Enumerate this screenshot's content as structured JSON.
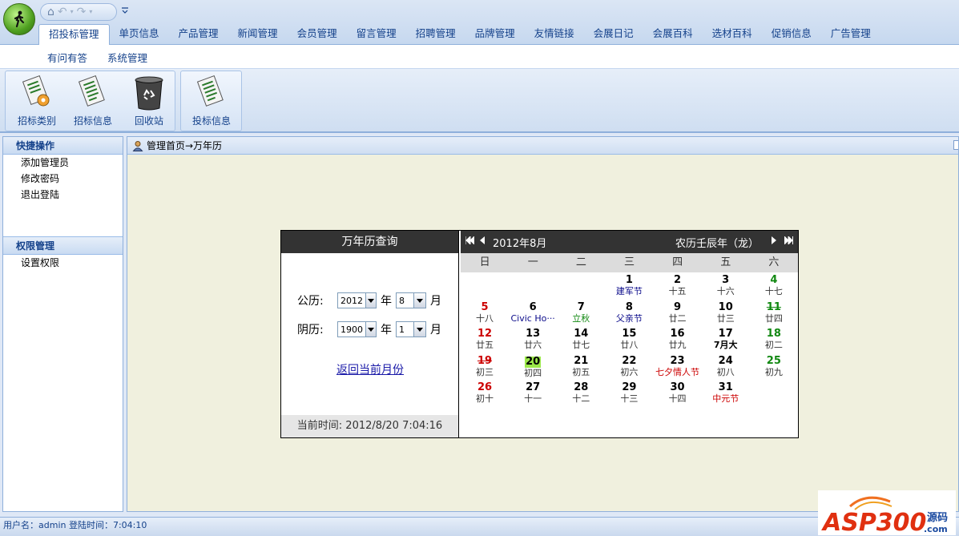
{
  "app": {
    "qat_icons": [
      "home-icon",
      "undo-icon",
      "redo-icon"
    ]
  },
  "ribbon": {
    "main_tabs": [
      "招投标管理",
      "单页信息",
      "产品管理",
      "新闻管理",
      "会员管理",
      "留言管理",
      "招聘管理",
      "品牌管理",
      "友情链接",
      "会展日记",
      "会展百科",
      "选材百科",
      "促销信息",
      "广告管理"
    ],
    "active_tab": 0,
    "sub_tabs": [
      "有问有答",
      "系统管理"
    ],
    "buttons": [
      {
        "label": "招标类别",
        "icon": "document-gear-icon"
      },
      {
        "label": "招标信息",
        "icon": "document-list-icon"
      },
      {
        "label": "回收站",
        "icon": "recycle-bin-icon"
      },
      {
        "label": "投标信息",
        "icon": "document-list-icon"
      }
    ]
  },
  "sidebar": {
    "section1_title": "快捷操作",
    "section1_items": [
      "添加管理员",
      "修改密码",
      "退出登陆"
    ],
    "section2_title": "权限管理",
    "section2_items": [
      "设置权限"
    ]
  },
  "breadcrumb": "管理首页→万年历",
  "calendar": {
    "query_title": "万年历查询",
    "solar_label": "公历:",
    "solar_year": "2012",
    "solar_month": "8",
    "lunar_label": "阴历:",
    "lunar_year": "1900",
    "lunar_month": "1",
    "year_unit": "年",
    "month_unit": "月",
    "back_link": "返回当前月份",
    "current_time": "当前时间: 2012/8/20 7:04:16",
    "year_month": "2012年8月",
    "lunar_year_label": "农历壬辰年（龙）",
    "weekdays": [
      "日",
      "一",
      "二",
      "三",
      "四",
      "五",
      "六"
    ],
    "first_weekday": 3,
    "today": 20,
    "days": [
      {
        "d": "1",
        "l": "建军节",
        "t": "hol"
      },
      {
        "d": "2",
        "l": "十五"
      },
      {
        "d": "3",
        "l": "十六"
      },
      {
        "d": "4",
        "l": "十七"
      },
      {
        "d": "5",
        "l": "十八"
      },
      {
        "d": "6",
        "l": "Civic Ho···",
        "t": "hol"
      },
      {
        "d": "7",
        "l": "立秋",
        "t": "green"
      },
      {
        "d": "8",
        "l": "父亲节",
        "t": "hol"
      },
      {
        "d": "9",
        "l": "廿二"
      },
      {
        "d": "10",
        "l": "廿三"
      },
      {
        "d": "11",
        "l": "廿四",
        "strike": true
      },
      {
        "d": "12",
        "l": "廿五"
      },
      {
        "d": "13",
        "l": "廿六"
      },
      {
        "d": "14",
        "l": "廿七"
      },
      {
        "d": "15",
        "l": "廿八"
      },
      {
        "d": "16",
        "l": "廿九"
      },
      {
        "d": "17",
        "l": "7月大",
        "t": "bold"
      },
      {
        "d": "18",
        "l": "初二"
      },
      {
        "d": "19",
        "l": "初三",
        "strike": true
      },
      {
        "d": "20",
        "l": "初四"
      },
      {
        "d": "21",
        "l": "初五"
      },
      {
        "d": "22",
        "l": "初六"
      },
      {
        "d": "23",
        "l": "七夕情人节",
        "t": "red"
      },
      {
        "d": "24",
        "l": "初八"
      },
      {
        "d": "25",
        "l": "初九"
      },
      {
        "d": "26",
        "l": "初十"
      },
      {
        "d": "27",
        "l": "十一"
      },
      {
        "d": "28",
        "l": "十二"
      },
      {
        "d": "29",
        "l": "十三"
      },
      {
        "d": "30",
        "l": "十四"
      },
      {
        "d": "31",
        "l": "中元节",
        "t": "red"
      }
    ]
  },
  "status": "用户名：admin 登陆时间：7:04:10",
  "colors": {
    "ribbon_text": "#15428b",
    "content_bg": "#f0f0de",
    "today_highlight": "#9be84a",
    "sunday": "#cc0000",
    "saturday": "#118811"
  }
}
